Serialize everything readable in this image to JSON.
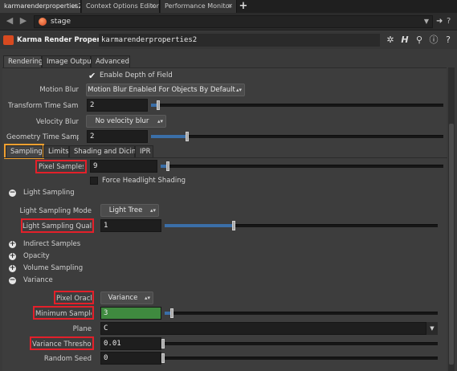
{
  "window_tabs": [
    {
      "label": "karmarenderproperties2",
      "active": true
    },
    {
      "label": "Context Options Editor",
      "active": false
    },
    {
      "label": "Performance Monitor",
      "active": false
    }
  ],
  "new_tab_label": "+",
  "path": {
    "value": "stage"
  },
  "node": {
    "type_label": "Karma Render Properties",
    "name": "karmarenderproperties2"
  },
  "main_tabs": [
    "Rendering",
    "Image Output",
    "Advanced"
  ],
  "rendering": {
    "depth_of_field": {
      "label": "Enable Depth of Field",
      "checked": true
    },
    "motion_blur": {
      "label": "Motion Blur",
      "value": "Motion Blur Enabled For Objects By Default"
    },
    "transform_time_samples": {
      "label": "Transform Time Sam...",
      "value": "2",
      "slider_fraction": 0.02
    },
    "velocity_blur": {
      "label": "Velocity Blur",
      "value": "No velocity blur"
    },
    "geometry_time_samples": {
      "label": "Geometry Time Samp...",
      "value": "2",
      "slider_fraction": 0.12
    }
  },
  "sub_tabs": [
    "Sampling",
    "Limits",
    "Shading and Dicing",
    "IPR"
  ],
  "sampling": {
    "pixel_samples": {
      "label": "Pixel Samples",
      "value": "9",
      "slider_fraction": 0.02
    },
    "force_headlight": {
      "label": "Force Headlight Shading",
      "checked": false
    },
    "light_sampling_folder": "Light Sampling",
    "light_sampling_mode": {
      "label": "Light Sampling Mode",
      "value": "Light Tree"
    },
    "light_sampling_quality": {
      "label": "Light Sampling Quality",
      "value": "1",
      "slider_fraction": 0.25
    },
    "folders_collapsed": [
      "Indirect Samples",
      "Opacity",
      "Volume Sampling"
    ],
    "variance_folder": "Variance",
    "pixel_oracle": {
      "label": "Pixel Oracle",
      "value": "Variance"
    },
    "minimum_samples": {
      "label": "Minimum Samples",
      "value": "3",
      "slider_fraction": 0.02
    },
    "plane": {
      "label": "Plane",
      "value": "C"
    },
    "variance_threshold": {
      "label": "Variance Threshold",
      "value": "0.01",
      "slider_fraction": 0.0
    },
    "random_seed": {
      "label": "Random Seed",
      "value": "0",
      "slider_fraction": 0.0
    }
  },
  "icons": {
    "back": "arrow-left-icon",
    "forward": "arrow-right-icon",
    "stage": "stage-icon",
    "pin": "pin-icon",
    "gear": "gear-icon",
    "h": "h-icon",
    "search": "search-icon",
    "info": "info-icon",
    "help": "help-icon"
  },
  "colors": {
    "highlight_red": "#e3202a",
    "highlight_orange": "#f0a030",
    "accent_green": "#3f8a3f",
    "slider_blue": "#3b6fa8"
  }
}
